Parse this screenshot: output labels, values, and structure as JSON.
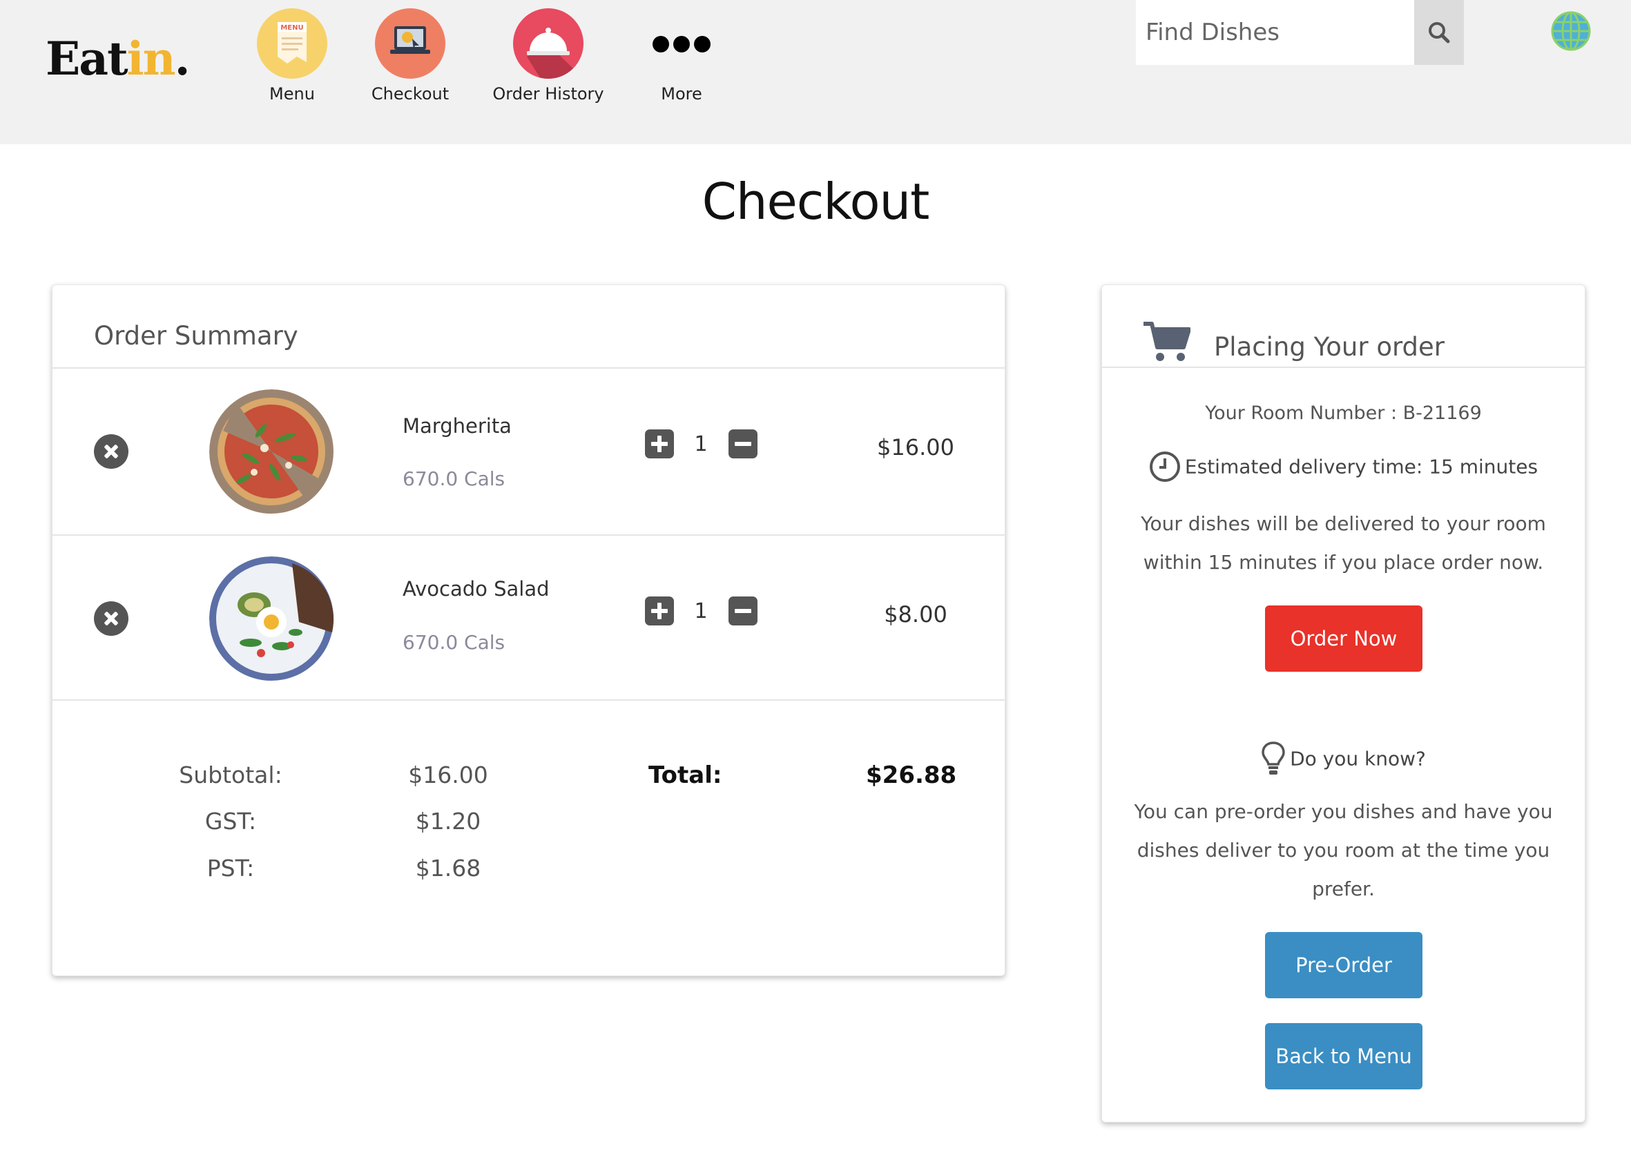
{
  "brand": {
    "name_main": "Eat",
    "name_accent": "in",
    "name_dot": "."
  },
  "nav": [
    {
      "label": "Menu",
      "icon": "menu-card-icon"
    },
    {
      "label": "Checkout",
      "icon": "laptop-payment-icon"
    },
    {
      "label": "Order History",
      "icon": "cloche-icon"
    },
    {
      "label": "More",
      "icon": "more-dots-icon"
    }
  ],
  "search": {
    "placeholder": "Find Dishes",
    "icon": "search-icon"
  },
  "language": {
    "icon": "globe-icon"
  },
  "page": {
    "title": "Checkout"
  },
  "order_summary": {
    "title": "Order Summary",
    "items": [
      {
        "name": "Margherita",
        "calories": "670.0 Cals",
        "quantity": "1",
        "price": "$16.00",
        "image": "pizza-image"
      },
      {
        "name": "Avocado Salad",
        "calories": "670.0 Cals",
        "quantity": "1",
        "price": "$8.00",
        "image": "salad-image"
      }
    ],
    "totals": {
      "subtotal_label": "Subtotal:",
      "subtotal_value": "$16.00",
      "gst_label": "GST:",
      "gst_value": "$1.20",
      "pst_label": "PST:",
      "pst_value": "$1.68",
      "total_label": "Total:",
      "total_value": "$26.88"
    }
  },
  "placing_order": {
    "title": "Placing Your order",
    "room_number": "Your Room Number : B-21169",
    "eta": "Estimated delivery time: 15 minutes",
    "delivery_note_line1": "Your dishes will be delivered to your room",
    "delivery_note_line2": "within 15 minutes if you place order now.",
    "order_now_label": "Order  Now",
    "do_you_know": "Do you know?",
    "tip_line1": "You can pre-order you dishes and have you",
    "tip_line2": "dishes deliver to you room at the time you",
    "tip_line3": "prefer.",
    "pre_order_label": "Pre-Order",
    "back_to_menu_label": "Back to Menu"
  },
  "colors": {
    "header_bg": "#f1f1f1",
    "accent_yellow": "#f2b531",
    "order_now_red": "#e8322a",
    "secondary_blue": "#3a8ec3",
    "icon_gray": "#555555"
  }
}
